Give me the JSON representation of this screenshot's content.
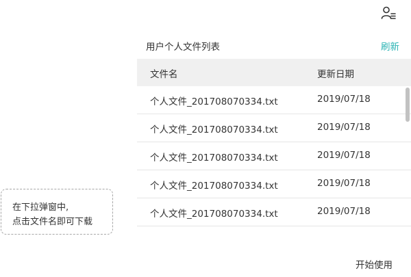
{
  "header": {
    "user_menu_icon": "user-list-icon"
  },
  "panel": {
    "title": "用户个人文件列表",
    "refresh_label": "刷新"
  },
  "table": {
    "columns": [
      "文件名",
      "更新日期"
    ],
    "rows": [
      {
        "name": "个人文件_201708070334.txt",
        "date": "2019/07/18"
      },
      {
        "name": "个人文件_201708070334.txt",
        "date": "2019/07/18"
      },
      {
        "name": "个人文件_201708070334.txt",
        "date": "2019/07/18"
      },
      {
        "name": "个人文件_201708070334.txt",
        "date": "2019/07/18"
      },
      {
        "name": "个人文件_201708070334.txt",
        "date": "2019/07/18"
      }
    ]
  },
  "tip": {
    "lines": [
      "在下拉弹窗中,",
      "点击文件名即可下载"
    ]
  },
  "footer": {
    "start_label": "开始使用"
  },
  "colors": {
    "accent": "#2bb4b4",
    "header_bg": "#f0f0f0",
    "text": "#333333",
    "border": "#e6e6e6",
    "scrollbar": "#c2c2c2"
  }
}
